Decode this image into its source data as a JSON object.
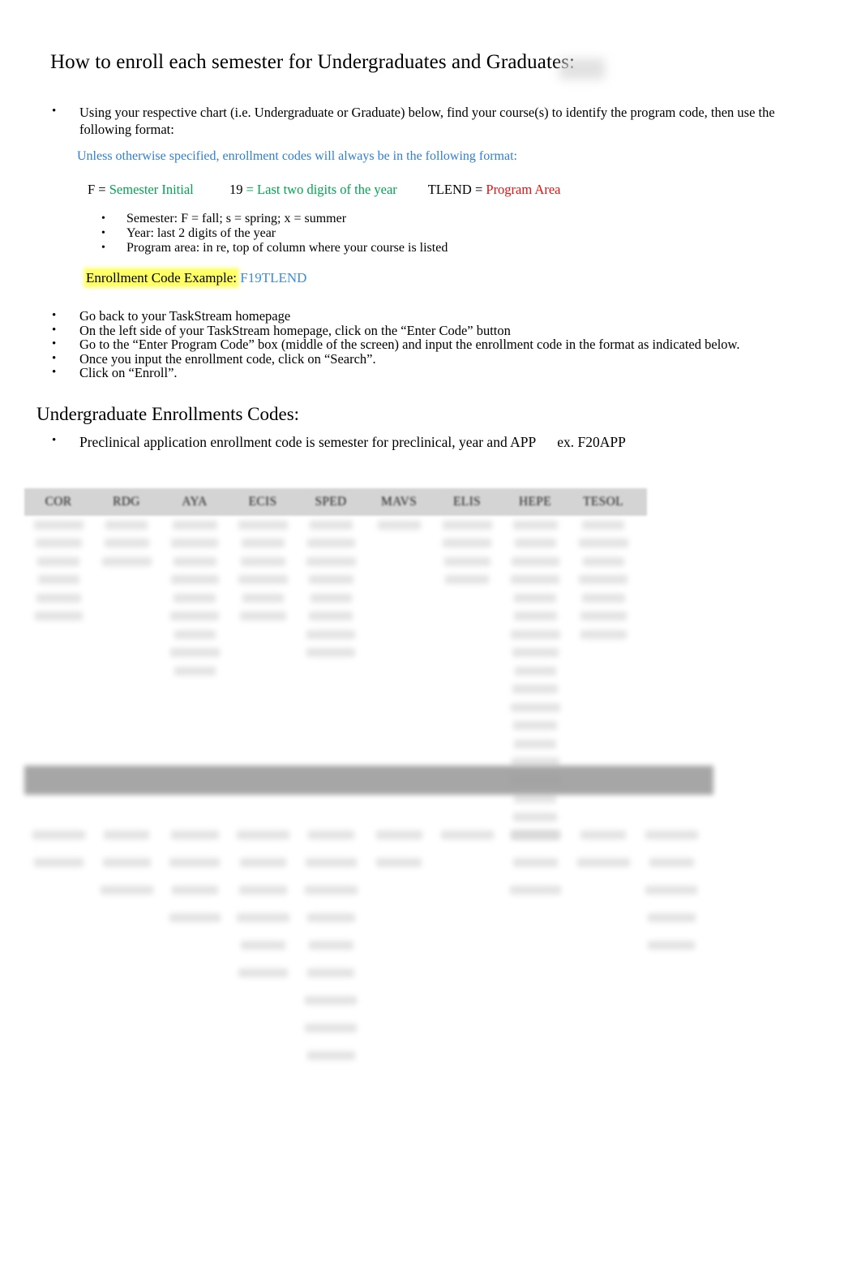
{
  "document": {
    "title": "How to enroll each semester for Undergraduates and Graduates:",
    "intro_bullet": "Using your respective chart (i.e. Undergraduate or Graduate) below, find your course(s) to identify the program code, then use the following format:",
    "format_note": "Unless otherwise specified, enrollment codes will always be in the following format:",
    "format_line": {
      "f_label": "F =",
      "f_value": "Semester Initial",
      "year_label": "19",
      "year_value": "= Last two digits of the year",
      "area_label": "TLEND =",
      "area_value": "Program Area"
    },
    "definitions": [
      "Semester:  F = fall; s = spring; x = summer",
      "Year:   last 2 digits of the year",
      "Program area:  in re, top of column where your course is listed"
    ],
    "example": {
      "label": "Enrollment Code Example:",
      "code": "F19TLEND"
    },
    "steps": [
      "Go back to your TaskStream homepage",
      "On the left side of your TaskStream homepage, click on the “Enter Code” button",
      "Go to the “Enter Program Code” box (middle of the screen) and input the enrollment code in the format as indicated below.",
      "Once you input the enrollment code, click on “Search”.",
      "Click on “Enroll”."
    ],
    "section_heading": "Undergraduate Enrollments Codes:",
    "preclinical_bullet": {
      "text": "Preclinical application enrollment code is semester for preclinical, year and APP",
      "example": "ex. F20APP"
    }
  },
  "table_undergraduate": {
    "columns": [
      "COR",
      "RDG",
      "AYA",
      "ECIS",
      "SPED",
      "MAVS",
      "ELIS",
      "HEPE",
      "TESOL"
    ],
    "row_counts": [
      6,
      3,
      9,
      6,
      8,
      1,
      4,
      18,
      7
    ],
    "body_state": "redacted"
  },
  "table_graduate": {
    "row_counts": [
      2,
      3,
      4,
      6,
      9,
      2,
      1,
      3,
      2,
      5
    ],
    "body_state": "redacted"
  },
  "colors": {
    "blue": "#2f7fd0",
    "green": "#00a550",
    "red": "#e81010",
    "code_blue": "#3b8fd4",
    "highlight": "#ffff66",
    "header_bg": "#d4d4d4"
  }
}
